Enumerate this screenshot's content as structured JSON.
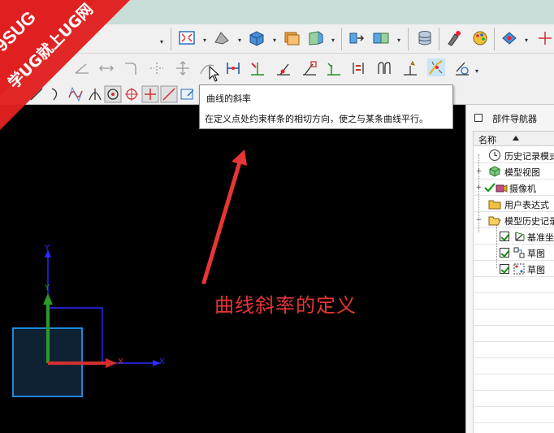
{
  "tooltip": {
    "title": "曲线的斜率",
    "description": "在定义点处约束样条的相切方向，使之与某条曲线平行。"
  },
  "annotation": {
    "text": "曲线斜率的定义"
  },
  "logo": {
    "line1": "9SUG",
    "line2": "学UG就上UG网"
  },
  "navigator": {
    "title": "部件导航器",
    "column_header": "名称",
    "items": [
      {
        "label": "历史记录模式",
        "icon": "clock-icon"
      },
      {
        "label": "模型视图",
        "icon": "model-views-icon"
      },
      {
        "label": "摄像机",
        "icon": "camera-icon"
      },
      {
        "label": "用户表达式",
        "icon": "folder-icon"
      },
      {
        "label": "模型历史记录",
        "icon": "folder-open-icon"
      },
      {
        "label": "基准坐标系",
        "icon": "datum-csys-icon"
      },
      {
        "label": "草图",
        "icon": "sketch-icon"
      },
      {
        "label": "草图",
        "icon": "sketch-icon"
      }
    ]
  },
  "axes": {
    "x_label": "X",
    "y_label": "Y"
  },
  "colors": {
    "accent_red": "#e63535",
    "logo_red": "#e02020",
    "square_blue": "#1e88d8"
  }
}
